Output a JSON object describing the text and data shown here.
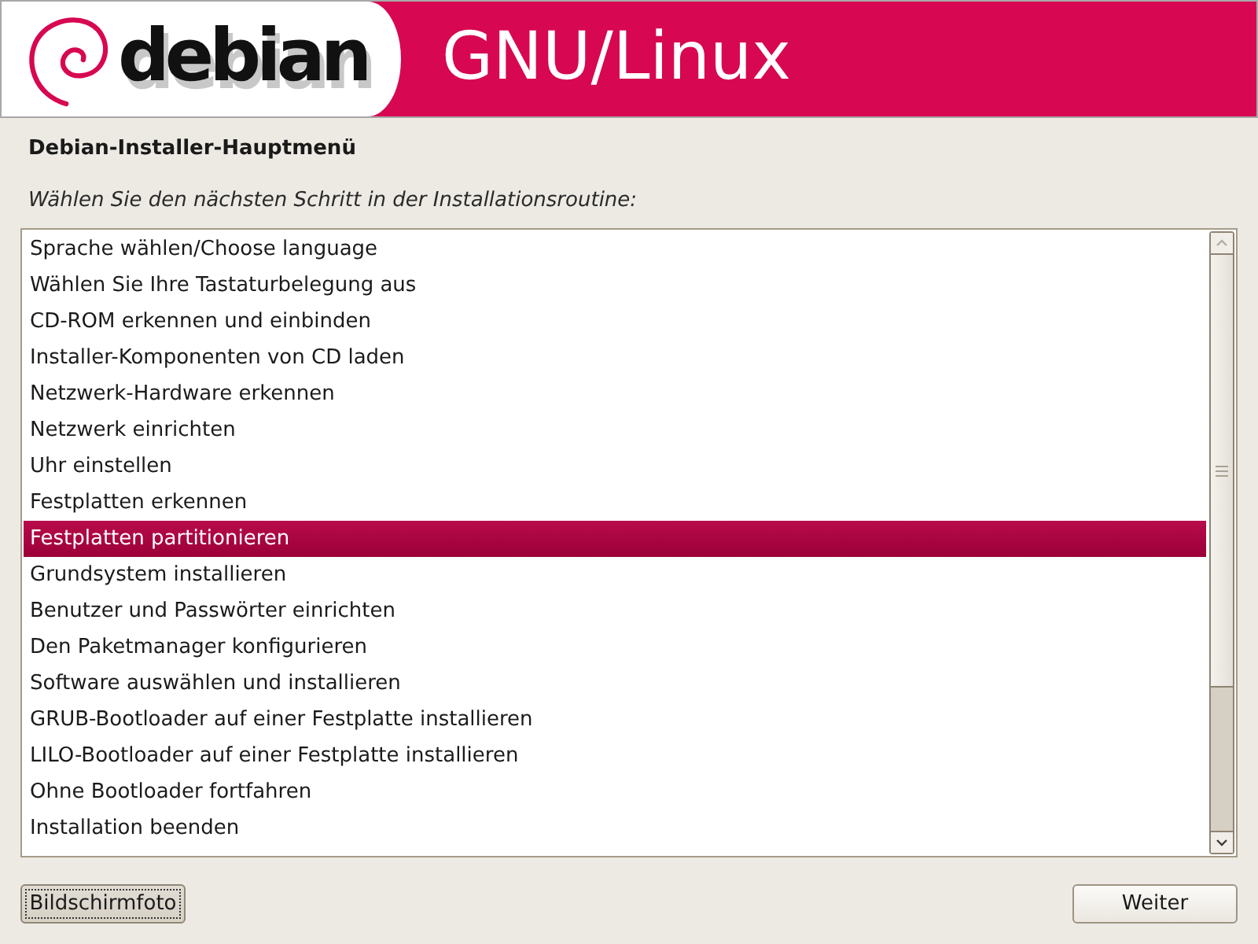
{
  "header": {
    "logo_text": "debian",
    "title": "GNU/Linux"
  },
  "dialog": {
    "title": "Debian-Installer-Hauptmenü",
    "prompt": "Wählen Sie den nächsten Schritt in der Installationsroutine:"
  },
  "menu": {
    "items": [
      {
        "label": "Sprache wählen/Choose language",
        "selected": false
      },
      {
        "label": "Wählen Sie Ihre Tastaturbelegung aus",
        "selected": false
      },
      {
        "label": "CD-ROM erkennen und einbinden",
        "selected": false
      },
      {
        "label": "Installer-Komponenten von CD laden",
        "selected": false
      },
      {
        "label": "Netzwerk-Hardware erkennen",
        "selected": false
      },
      {
        "label": "Netzwerk einrichten",
        "selected": false
      },
      {
        "label": "Uhr einstellen",
        "selected": false
      },
      {
        "label": "Festplatten erkennen",
        "selected": false
      },
      {
        "label": "Festplatten partitionieren",
        "selected": true
      },
      {
        "label": "Grundsystem installieren",
        "selected": false
      },
      {
        "label": "Benutzer und Passwörter einrichten",
        "selected": false
      },
      {
        "label": "Den Paketmanager konfigurieren",
        "selected": false
      },
      {
        "label": "Software auswählen und installieren",
        "selected": false
      },
      {
        "label": "GRUB-Bootloader auf einer Festplatte installieren",
        "selected": false
      },
      {
        "label": "LILO-Bootloader auf einer Festplatte installieren",
        "selected": false
      },
      {
        "label": "Ohne Bootloader fortfahren",
        "selected": false
      },
      {
        "label": "Installation beenden",
        "selected": false
      }
    ]
  },
  "buttons": [
    {
      "label": "Bildschirmfoto",
      "focused": true
    },
    {
      "label": "Weiter",
      "focused": false
    }
  ]
}
